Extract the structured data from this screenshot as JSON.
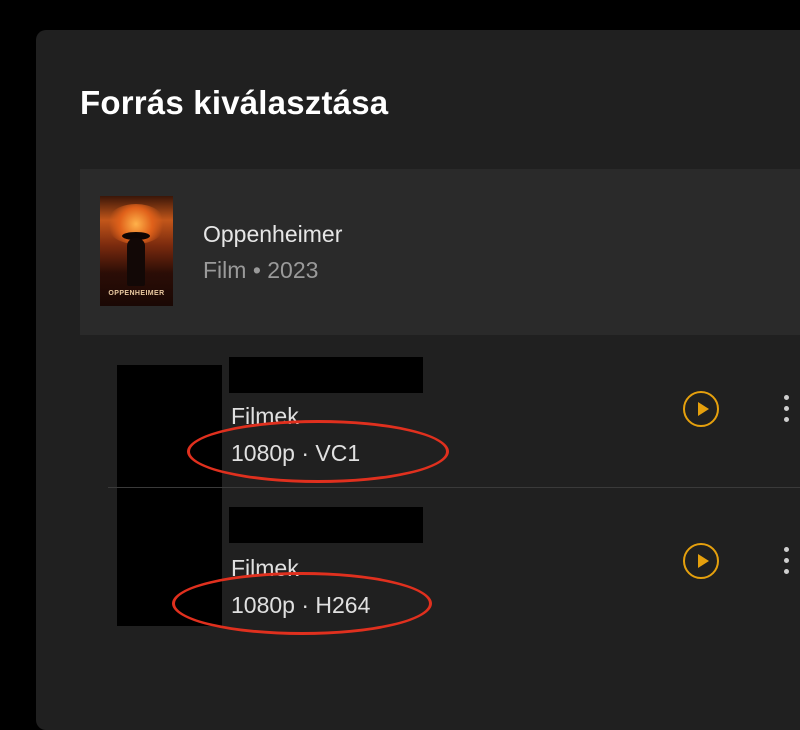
{
  "dialog": {
    "title": "Forrás kiválasztása"
  },
  "movie": {
    "name": "Oppenheimer",
    "meta": "Film • 2023",
    "poster_label": "OPPENHEIMER"
  },
  "sources": [
    {
      "library": "Filmek",
      "quality": "1080p · VC1"
    },
    {
      "library": "Filmek",
      "quality": "1080p · H264"
    }
  ],
  "icons": {
    "play": "play-circle-icon",
    "more": "more-vertical-icon"
  },
  "colors": {
    "accent": "#e5a00d",
    "annotation": "#e0301e",
    "dialog_bg": "#202020",
    "card_bg": "#2a2a2a"
  }
}
